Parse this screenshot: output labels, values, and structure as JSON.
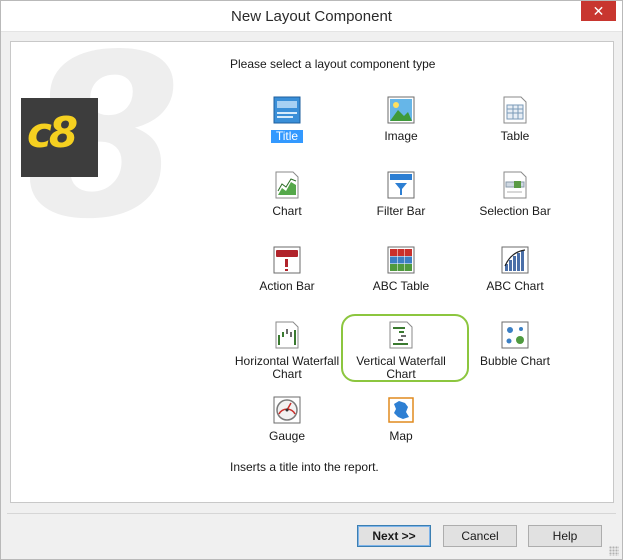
{
  "window": {
    "title": "New Layout Component",
    "close_glyph": "✕"
  },
  "logo": {
    "text": "c8"
  },
  "prompt": "Please select a layout component type",
  "components": [
    {
      "label": "Title",
      "icon": "title-icon",
      "selected": true
    },
    {
      "label": "Image",
      "icon": "image-icon"
    },
    {
      "label": "Table",
      "icon": "table-icon"
    },
    {
      "label": "Chart",
      "icon": "chart-icon"
    },
    {
      "label": "Filter Bar",
      "icon": "filter-bar-icon"
    },
    {
      "label": "Selection Bar",
      "icon": "selection-bar-icon"
    },
    {
      "label": "Action Bar",
      "icon": "action-bar-icon"
    },
    {
      "label": "ABC Table",
      "icon": "abc-table-icon"
    },
    {
      "label": "ABC Chart",
      "icon": "abc-chart-icon"
    },
    {
      "label": "Horizontal Waterfall Chart",
      "icon": "horizontal-waterfall-icon"
    },
    {
      "label": "Vertical Waterfall Chart",
      "icon": "vertical-waterfall-icon",
      "highlighted": true
    },
    {
      "label": "Bubble Chart",
      "icon": "bubble-chart-icon"
    },
    {
      "label": "Gauge",
      "icon": "gauge-icon"
    },
    {
      "label": "Map",
      "icon": "map-icon"
    }
  ],
  "status": "Inserts a title into the report.",
  "buttons": {
    "next": "Next",
    "next_arrows": ">>",
    "cancel": "Cancel",
    "help": "Help"
  },
  "colors": {
    "selection": "#3399ff",
    "highlight_ring": "#8cc63f",
    "close_button": "#c8362f",
    "logo_bg": "#3d3d3d",
    "logo_fg": "#f5d020"
  }
}
